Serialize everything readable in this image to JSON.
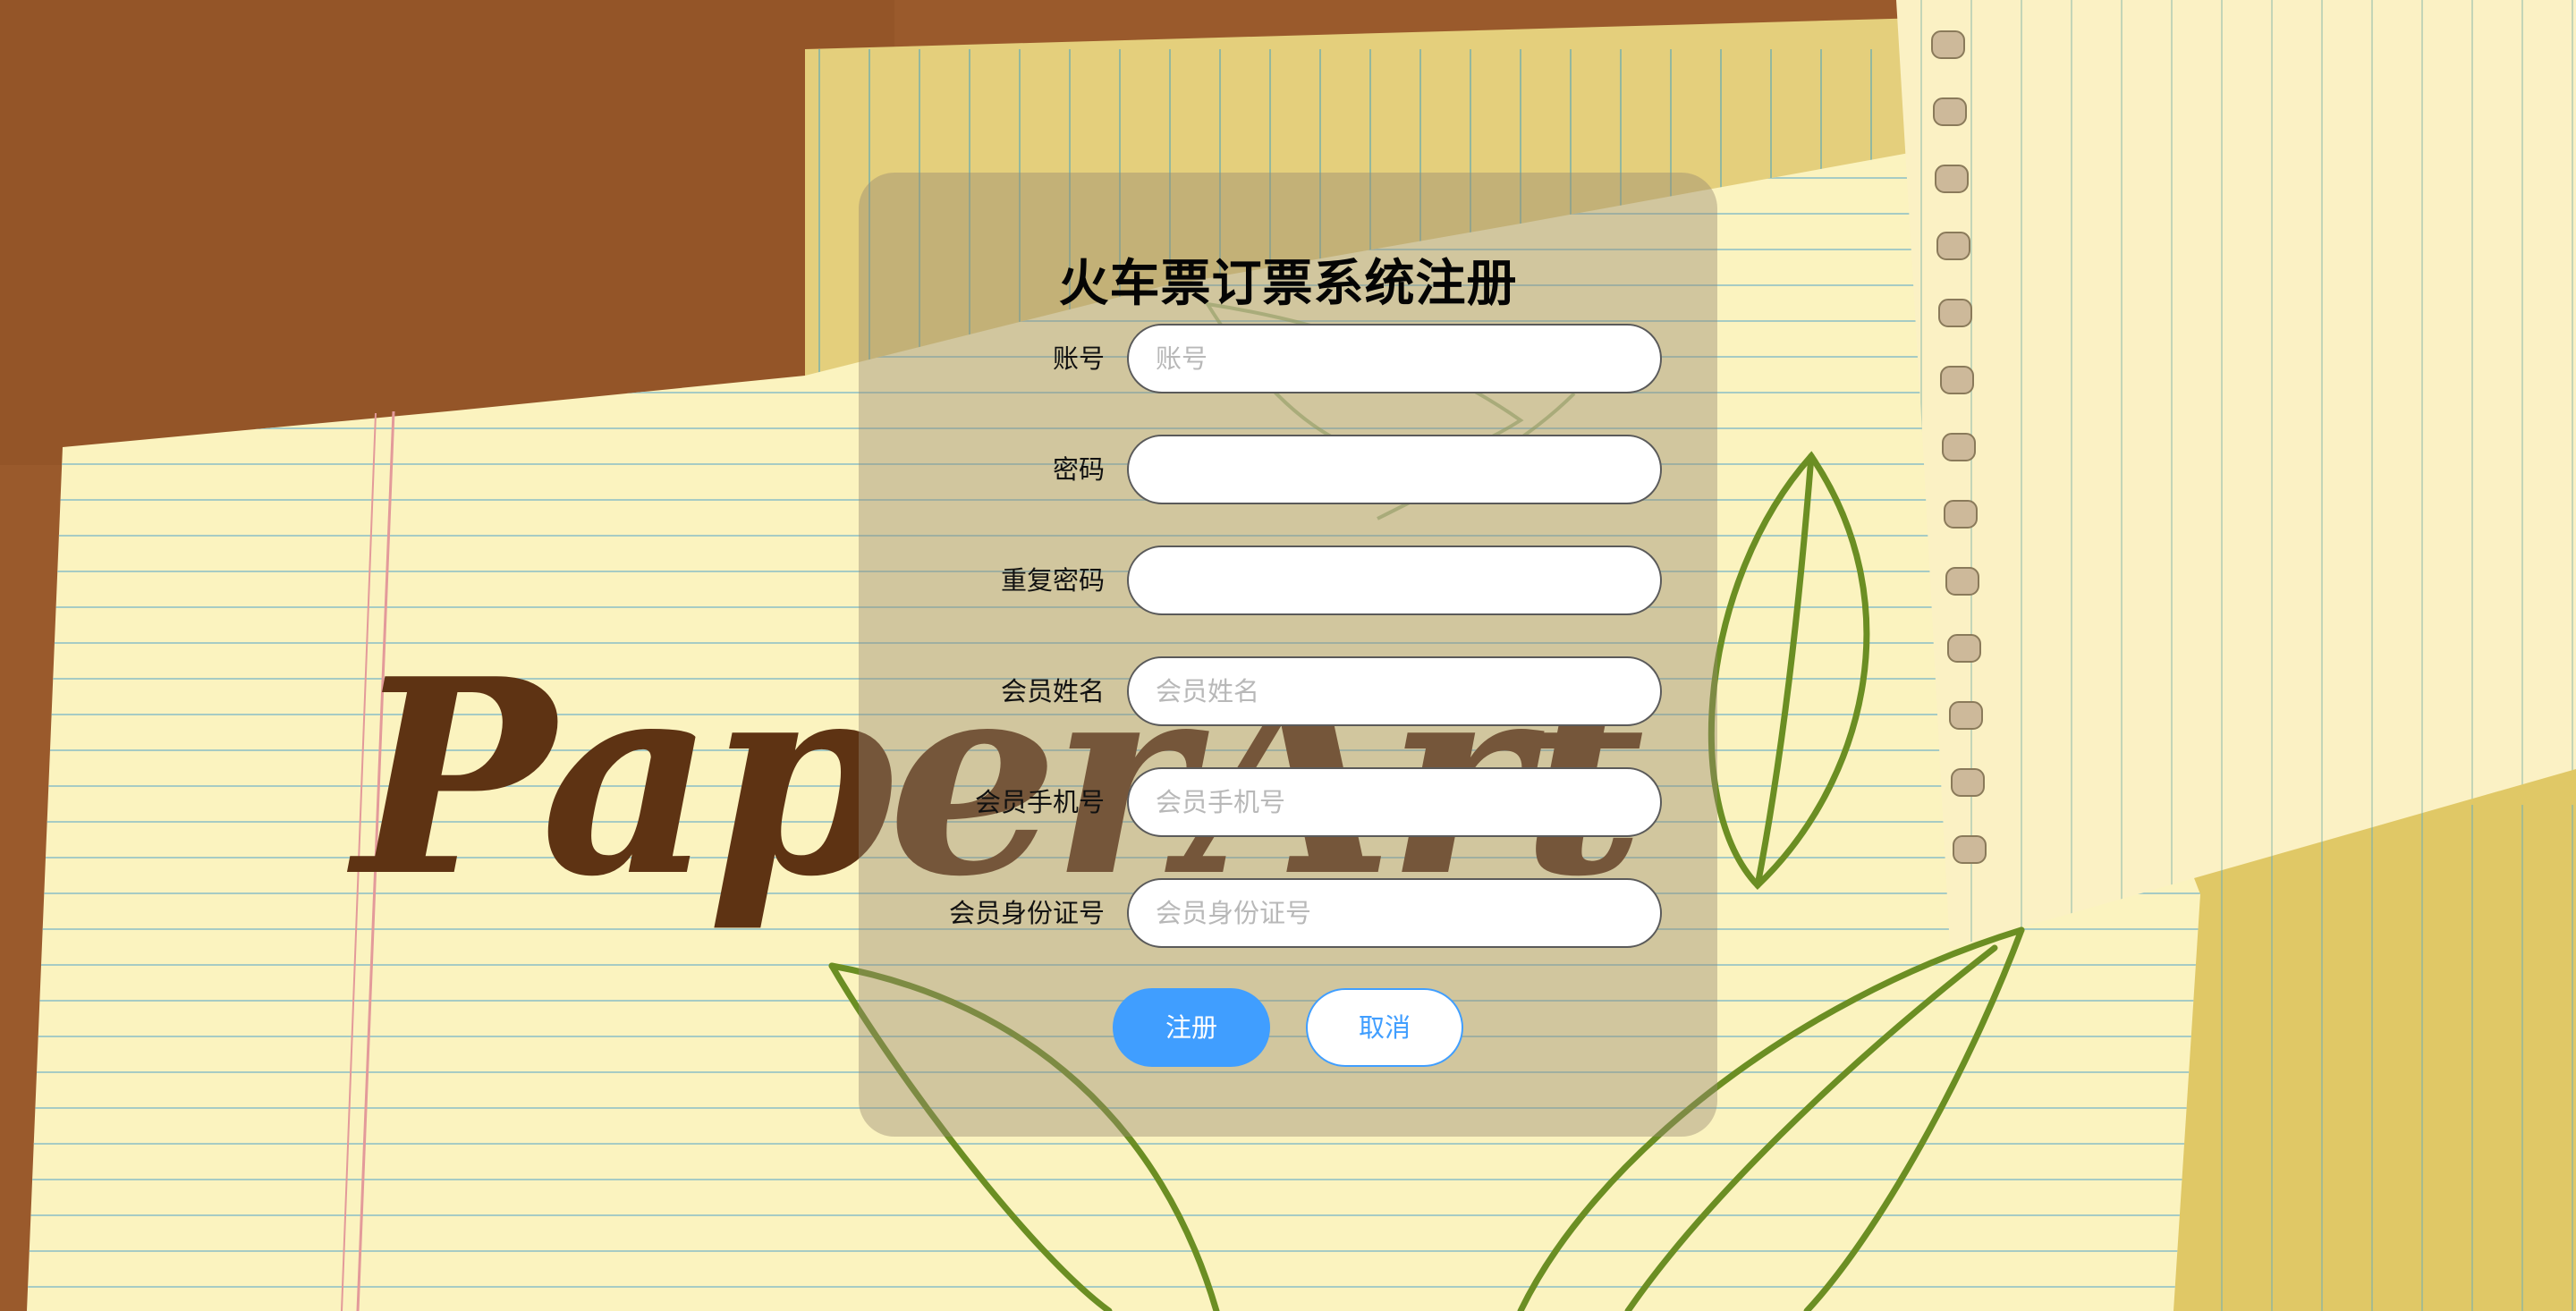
{
  "form": {
    "title": "火车票订票系统注册",
    "fields": [
      {
        "label": "账号",
        "placeholder": "账号",
        "value": ""
      },
      {
        "label": "密码",
        "placeholder": "",
        "value": ""
      },
      {
        "label": "重复密码",
        "placeholder": "",
        "value": ""
      },
      {
        "label": "会员姓名",
        "placeholder": "会员姓名",
        "value": ""
      },
      {
        "label": "会员手机号",
        "placeholder": "会员手机号",
        "value": ""
      },
      {
        "label": "会员身份证号",
        "placeholder": "会员身份证号",
        "value": ""
      }
    ],
    "register_label": "注册",
    "cancel_label": "取消"
  },
  "background": {
    "wordmark": "PaperArt"
  },
  "colors": {
    "accent": "#409eff",
    "panel": "#968770",
    "paper": "#fbf3bf",
    "cardboard": "#9a5a2c",
    "leaf": "#6b8e23"
  }
}
